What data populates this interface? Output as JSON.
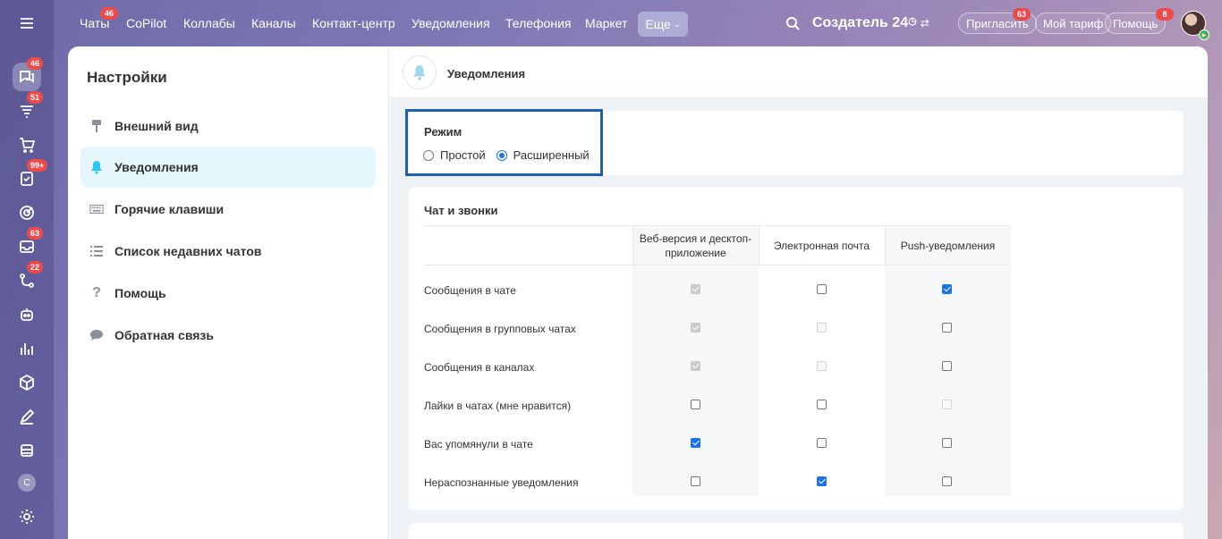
{
  "rail": {
    "items": [
      {
        "name": "menu-icon",
        "badge": ""
      },
      {
        "name": "chat-icon",
        "badge": "46"
      },
      {
        "name": "funnel-icon",
        "badge": "51"
      },
      {
        "name": "cart-icon",
        "badge": ""
      },
      {
        "name": "tasks-icon",
        "badge": "99+"
      },
      {
        "name": "target-icon",
        "badge": ""
      },
      {
        "name": "inbox-icon",
        "badge": "63"
      },
      {
        "name": "flow-icon",
        "badge": "22"
      },
      {
        "name": "robot-icon",
        "badge": ""
      },
      {
        "name": "analytics-icon",
        "badge": ""
      },
      {
        "name": "box-icon",
        "badge": ""
      },
      {
        "name": "sign-icon",
        "badge": ""
      },
      {
        "name": "storage-icon",
        "badge": ""
      }
    ],
    "avatar_letter": "C",
    "settings_icon": "gear-icon"
  },
  "topnav": {
    "items": [
      {
        "label": "Чаты",
        "badge": "46"
      },
      {
        "label": "CoPilot",
        "badge": ""
      },
      {
        "label": "Коллабы",
        "badge": ""
      },
      {
        "label": "Каналы",
        "badge": ""
      },
      {
        "label": "Контакт-центр",
        "badge": ""
      },
      {
        "label": "Уведомления",
        "badge": ""
      },
      {
        "label": "Телефония",
        "badge": ""
      },
      {
        "label": "Маркет",
        "badge": ""
      }
    ],
    "more_label": "Еще",
    "brand": "Создатель 24",
    "invite_label": "Пригласить",
    "invite_badge": "63",
    "tariff_label": "Мой тариф",
    "help_label": "Помощь",
    "help_badge": "8"
  },
  "sidebar": {
    "title": "Настройки",
    "items": [
      {
        "label": "Внешний вид",
        "icon": "brush-icon",
        "active": false
      },
      {
        "label": "Уведомления",
        "icon": "bell-icon",
        "active": true
      },
      {
        "label": "Горячие клавиши",
        "icon": "keyboard-icon",
        "active": false
      },
      {
        "label": "Список недавних чатов",
        "icon": "list-icon",
        "active": false
      },
      {
        "label": "Помощь",
        "icon": "question-icon",
        "active": false
      },
      {
        "label": "Обратная связь",
        "icon": "speech-bubble-icon",
        "active": false
      }
    ]
  },
  "content": {
    "title": "Уведомления",
    "mode": {
      "label": "Режим",
      "options": [
        "Простой",
        "Расширенный"
      ],
      "selected": "Расширенный"
    },
    "chat_section": {
      "title": "Чат и звонки",
      "columns": [
        "Веб-версия и десктоп-приложение",
        "Электронная почта",
        "Push-уведомления"
      ],
      "rows": [
        {
          "label": "Сообщения в чате",
          "cells": [
            {
              "checked": true,
              "disabled": true
            },
            {
              "checked": false,
              "disabled": false
            },
            {
              "checked": true,
              "disabled": false
            }
          ]
        },
        {
          "label": "Сообщения в групповых чатах",
          "cells": [
            {
              "checked": true,
              "disabled": true
            },
            {
              "checked": false,
              "disabled": true
            },
            {
              "checked": false,
              "disabled": false
            }
          ]
        },
        {
          "label": "Сообщения в каналах",
          "cells": [
            {
              "checked": true,
              "disabled": true
            },
            {
              "checked": false,
              "disabled": true
            },
            {
              "checked": false,
              "disabled": false
            }
          ]
        },
        {
          "label": "Лайки в чатах (мне нравится)",
          "cells": [
            {
              "checked": false,
              "disabled": false
            },
            {
              "checked": false,
              "disabled": false
            },
            {
              "checked": false,
              "disabled": true
            }
          ]
        },
        {
          "label": "Вас упомянули в чате",
          "cells": [
            {
              "checked": true,
              "disabled": false
            },
            {
              "checked": false,
              "disabled": false
            },
            {
              "checked": false,
              "disabled": false
            }
          ]
        },
        {
          "label": "Нераспознанные уведомления",
          "cells": [
            {
              "checked": false,
              "disabled": false
            },
            {
              "checked": true,
              "disabled": false
            },
            {
              "checked": false,
              "disabled": false
            }
          ]
        }
      ]
    }
  }
}
